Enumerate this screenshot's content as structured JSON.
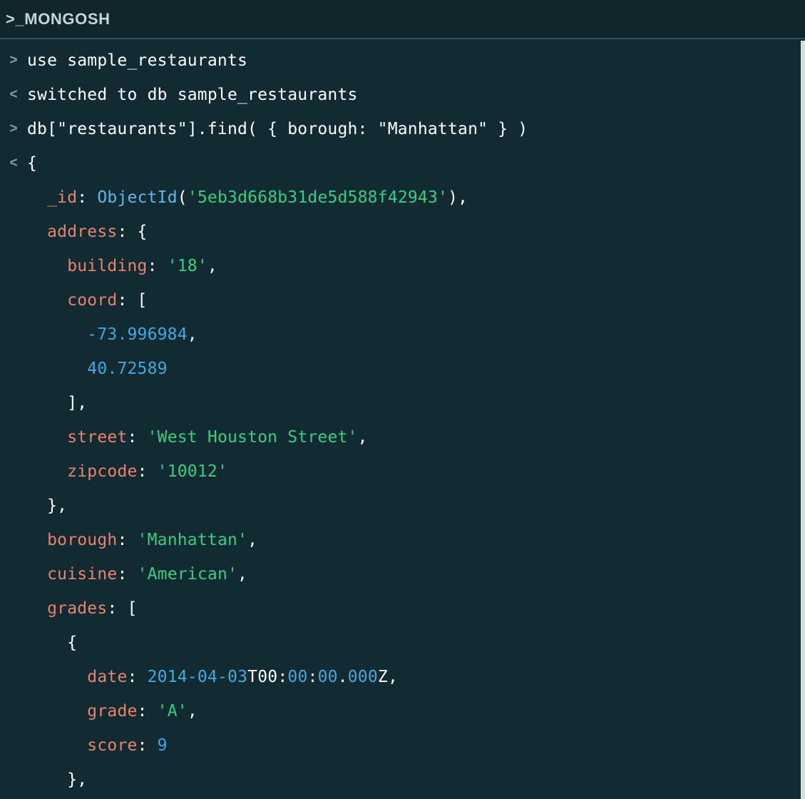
{
  "header": {
    "logo_prefix": ">_",
    "logo_text": "MONGOSH",
    "logo_full": ">_MONGOSH"
  },
  "colors": {
    "background": "#122B33",
    "header_background": "#10252C",
    "header_border": "#31515C",
    "text": "#FFFFFF",
    "gutter": "#8C9BA1",
    "key": "#E8836C",
    "string": "#35D07F",
    "number": "#41A8E0",
    "function": "#5FB8E8",
    "scrollbar": "#D5DEE1"
  },
  "gutter_icons": {
    "input": ">",
    "output": "<",
    "none": ""
  },
  "console_lines": [
    {
      "gutter": "input",
      "indent": 0,
      "text": "use sample_restaurants",
      "tokens": [
        {
          "t": "use sample_restaurants",
          "c": "plain"
        }
      ]
    },
    {
      "gutter": "output",
      "indent": 0,
      "text": "switched to db sample_restaurants",
      "tokens": [
        {
          "t": "switched to db sample_restaurants",
          "c": "plain"
        }
      ]
    },
    {
      "gutter": "input",
      "indent": 0,
      "text": "db[\"restaurants\"].find( { borough: \"Manhattan\" } )",
      "tokens": [
        {
          "t": "db[\"restaurants\"].find( { borough: \"Manhattan\" } )",
          "c": "plain"
        }
      ]
    },
    {
      "gutter": "output",
      "indent": 0,
      "text": "{",
      "tokens": [
        {
          "t": "{",
          "c": "punct"
        }
      ]
    },
    {
      "gutter": "none",
      "indent": 1,
      "text": "_id: ObjectId('5eb3d668b31de5d588f42943'),",
      "tokens": [
        {
          "t": "_id",
          "c": "key"
        },
        {
          "t": ": ",
          "c": "punct"
        },
        {
          "t": "ObjectId",
          "c": "func"
        },
        {
          "t": "(",
          "c": "punct"
        },
        {
          "t": "'5eb3d668b31de5d588f42943'",
          "c": "string"
        },
        {
          "t": "),",
          "c": "punct"
        }
      ]
    },
    {
      "gutter": "none",
      "indent": 1,
      "text": "address: {",
      "tokens": [
        {
          "t": "address",
          "c": "key"
        },
        {
          "t": ": {",
          "c": "punct"
        }
      ]
    },
    {
      "gutter": "none",
      "indent": 2,
      "text": "building: '18',",
      "tokens": [
        {
          "t": "building",
          "c": "key"
        },
        {
          "t": ": ",
          "c": "punct"
        },
        {
          "t": "'18'",
          "c": "string"
        },
        {
          "t": ",",
          "c": "punct"
        }
      ]
    },
    {
      "gutter": "none",
      "indent": 2,
      "text": "coord: [",
      "tokens": [
        {
          "t": "coord",
          "c": "key"
        },
        {
          "t": ": [",
          "c": "punct"
        }
      ]
    },
    {
      "gutter": "none",
      "indent": 3,
      "text": "-73.996984,",
      "tokens": [
        {
          "t": "-73.996984",
          "c": "number"
        },
        {
          "t": ",",
          "c": "punct"
        }
      ]
    },
    {
      "gutter": "none",
      "indent": 3,
      "text": "40.72589",
      "tokens": [
        {
          "t": "40.72589",
          "c": "number"
        }
      ]
    },
    {
      "gutter": "none",
      "indent": 2,
      "text": "],",
      "tokens": [
        {
          "t": "],",
          "c": "punct"
        }
      ]
    },
    {
      "gutter": "none",
      "indent": 2,
      "text": "street: 'West Houston Street',",
      "tokens": [
        {
          "t": "street",
          "c": "key"
        },
        {
          "t": ": ",
          "c": "punct"
        },
        {
          "t": "'West Houston Street'",
          "c": "string"
        },
        {
          "t": ",",
          "c": "punct"
        }
      ]
    },
    {
      "gutter": "none",
      "indent": 2,
      "text": "zipcode: '10012'",
      "tokens": [
        {
          "t": "zipcode",
          "c": "key"
        },
        {
          "t": ": ",
          "c": "punct"
        },
        {
          "t": "'10012'",
          "c": "string"
        }
      ]
    },
    {
      "gutter": "none",
      "indent": 1,
      "text": "},",
      "tokens": [
        {
          "t": "},",
          "c": "punct"
        }
      ]
    },
    {
      "gutter": "none",
      "indent": 1,
      "text": "borough: 'Manhattan',",
      "tokens": [
        {
          "t": "borough",
          "c": "key"
        },
        {
          "t": ": ",
          "c": "punct"
        },
        {
          "t": "'Manhattan'",
          "c": "string"
        },
        {
          "t": ",",
          "c": "punct"
        }
      ]
    },
    {
      "gutter": "none",
      "indent": 1,
      "text": "cuisine: 'American',",
      "tokens": [
        {
          "t": "cuisine",
          "c": "key"
        },
        {
          "t": ": ",
          "c": "punct"
        },
        {
          "t": "'American'",
          "c": "string"
        },
        {
          "t": ",",
          "c": "punct"
        }
      ]
    },
    {
      "gutter": "none",
      "indent": 1,
      "text": "grades: [",
      "tokens": [
        {
          "t": "grades",
          "c": "key"
        },
        {
          "t": ": [",
          "c": "punct"
        }
      ]
    },
    {
      "gutter": "none",
      "indent": 2,
      "text": "{",
      "tokens": [
        {
          "t": "{",
          "c": "punct"
        }
      ]
    },
    {
      "gutter": "none",
      "indent": 3,
      "text": "date: 2014-04-03T00:00:00.000Z,",
      "tokens": [
        {
          "t": "date",
          "c": "key"
        },
        {
          "t": ": ",
          "c": "punct"
        },
        {
          "t": "2014",
          "c": "number"
        },
        {
          "t": "-",
          "c": "number"
        },
        {
          "t": "04",
          "c": "number"
        },
        {
          "t": "-",
          "c": "number"
        },
        {
          "t": "03",
          "c": "number"
        },
        {
          "t": "T",
          "c": "plain"
        },
        {
          "t": "00",
          "c": "plain"
        },
        {
          "t": ":",
          "c": "plain"
        },
        {
          "t": "00",
          "c": "number"
        },
        {
          "t": ":",
          "c": "plain"
        },
        {
          "t": "00",
          "c": "number"
        },
        {
          "t": ".",
          "c": "plain"
        },
        {
          "t": "000",
          "c": "number"
        },
        {
          "t": "Z,",
          "c": "plain"
        }
      ]
    },
    {
      "gutter": "none",
      "indent": 3,
      "text": "grade: 'A',",
      "tokens": [
        {
          "t": "grade",
          "c": "key"
        },
        {
          "t": ": ",
          "c": "punct"
        },
        {
          "t": "'A'",
          "c": "string"
        },
        {
          "t": ",",
          "c": "punct"
        }
      ]
    },
    {
      "gutter": "none",
      "indent": 3,
      "text": "score: 9",
      "tokens": [
        {
          "t": "score",
          "c": "key"
        },
        {
          "t": ": ",
          "c": "punct"
        },
        {
          "t": "9",
          "c": "number"
        }
      ]
    },
    {
      "gutter": "none",
      "indent": 2,
      "text": "},",
      "tokens": [
        {
          "t": "},",
          "c": "punct"
        }
      ]
    }
  ]
}
